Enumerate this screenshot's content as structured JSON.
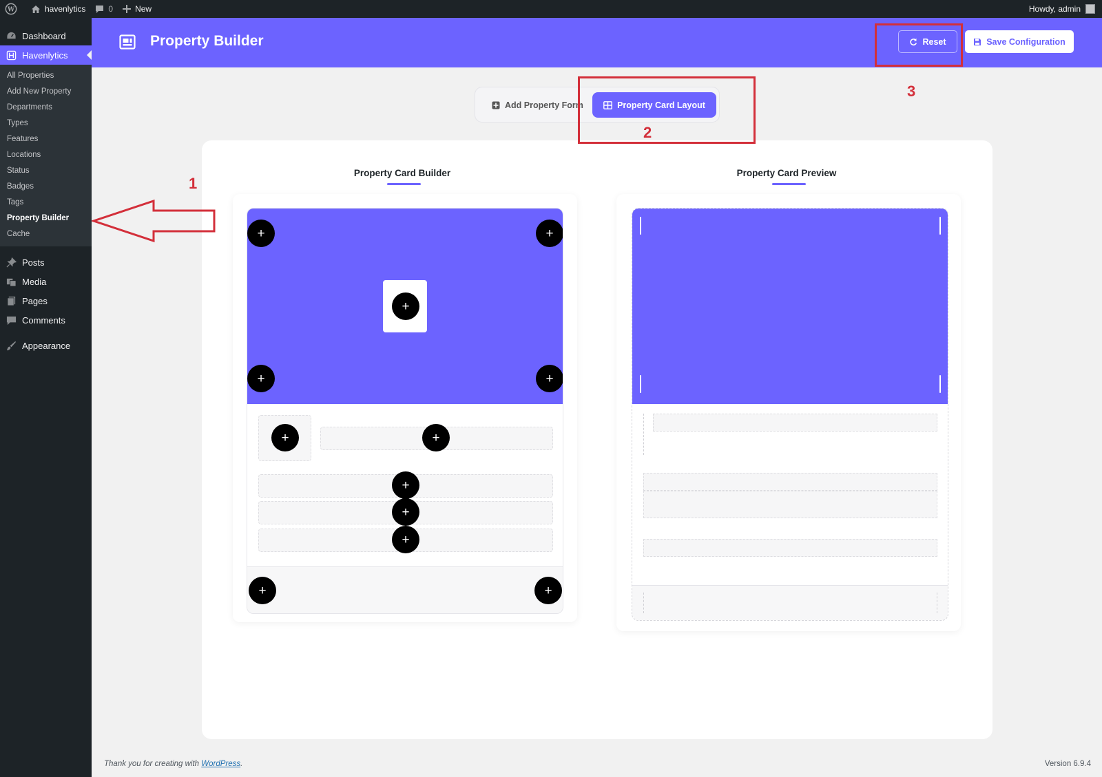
{
  "adminbar": {
    "site_name": "havenlytics",
    "comments_count": "0",
    "new_label": "New",
    "howdy": "Howdy, admin"
  },
  "sidebar": {
    "items": [
      {
        "label": "Dashboard",
        "icon": "dashboard-icon"
      },
      {
        "label": "Havenlytics",
        "icon": "havenlytics-icon",
        "active": true
      },
      {
        "label": "Posts",
        "icon": "pin-icon"
      },
      {
        "label": "Media",
        "icon": "media-icon"
      },
      {
        "label": "Pages",
        "icon": "pages-icon"
      },
      {
        "label": "Comments",
        "icon": "comments-icon"
      },
      {
        "label": "Appearance",
        "icon": "brush-icon"
      }
    ],
    "submenu": [
      "All Properties",
      "Add New Property",
      "Departments",
      "Types",
      "Features",
      "Locations",
      "Status",
      "Badges",
      "Tags",
      "Property Builder",
      "Cache"
    ],
    "current_submenu": "Property Builder"
  },
  "header": {
    "title": "Property Builder",
    "reset_label": "Reset",
    "save_label": "Save Configuration"
  },
  "tabs": {
    "inactive_label": "Add Property Form",
    "active_label": "Property Card Layout"
  },
  "builder": {
    "title": "Property Card Builder",
    "plus_glyph": "+"
  },
  "preview": {
    "title": "Property Card Preview"
  },
  "annotations": [
    "1",
    "2",
    "3"
  ],
  "footer": {
    "thank_you": "Thank you for creating with",
    "wp_link": "WordPress",
    "period": ".",
    "version": "Version 6.9.4"
  },
  "colors": {
    "accent": "#6c63ff",
    "admin_dark": "#1d2327",
    "annotation_red": "#d32f3a"
  }
}
